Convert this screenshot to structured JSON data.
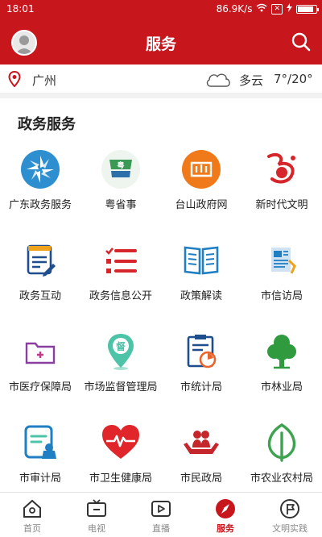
{
  "status_bar": {
    "time": "18:01",
    "network_speed": "86.9K/s",
    "battery_level": 0.85
  },
  "header": {
    "title": "服务"
  },
  "location_bar": {
    "city": "广州",
    "weather": "多云",
    "temperature": "7°/20°"
  },
  "section": {
    "title": "政务服务",
    "items": [
      {
        "label": "广东政务服务",
        "icon": "guangdong-gov-logo-icon"
      },
      {
        "label": "粤省事",
        "icon": "yueshengshi-logo-icon"
      },
      {
        "label": "台山政府网",
        "icon": "taishan-gov-logo-icon"
      },
      {
        "label": "新时代文明",
        "icon": "civilization-logo-icon"
      },
      {
        "label": "政务互动",
        "icon": "document-edit-icon"
      },
      {
        "label": "政务信息公开",
        "icon": "checklist-icon"
      },
      {
        "label": "政策解读",
        "icon": "open-book-icon"
      },
      {
        "label": "市信访局",
        "icon": "petition-document-icon"
      },
      {
        "label": "市医疗保障局",
        "icon": "medical-folder-icon"
      },
      {
        "label": "市场监督管理局",
        "icon": "supervision-pin-icon"
      },
      {
        "label": "市统计局",
        "icon": "statistics-clipboard-icon"
      },
      {
        "label": "市林业局",
        "icon": "tree-icon"
      },
      {
        "label": "市审计局",
        "icon": "audit-document-icon"
      },
      {
        "label": "市卫生健康局",
        "icon": "heart-pulse-icon"
      },
      {
        "label": "市民政局",
        "icon": "hands-people-icon"
      },
      {
        "label": "市农业农村局",
        "icon": "leaf-icon"
      }
    ]
  },
  "tabbar": {
    "tabs": [
      {
        "label": "首页",
        "icon": "home-icon"
      },
      {
        "label": "电视",
        "icon": "tv-icon"
      },
      {
        "label": "直播",
        "icon": "live-video-icon"
      },
      {
        "label": "服务",
        "icon": "compass-icon",
        "active": true
      },
      {
        "label": "文明实践",
        "icon": "flag-badge-icon"
      }
    ]
  },
  "colors": {
    "brand": "#c8161d",
    "active_tab": "#c8161d",
    "inactive_tab": "#888888"
  }
}
